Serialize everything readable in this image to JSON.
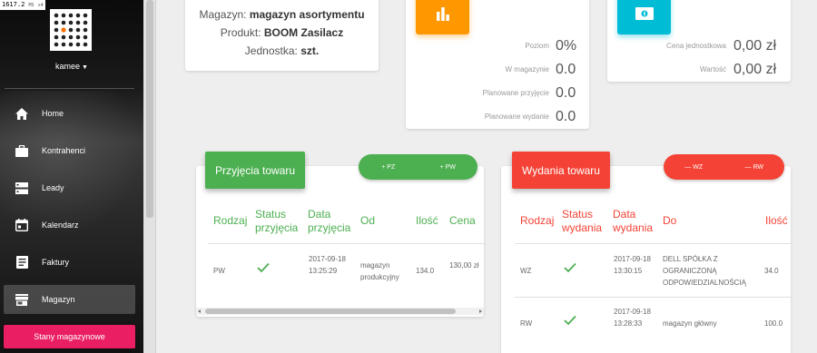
{
  "fps": {
    "value": "1617.2",
    "unit": "MS",
    "extra": "x4"
  },
  "sidebar": {
    "user": "kamee",
    "items": [
      {
        "label": "Home",
        "icon": "home-icon"
      },
      {
        "label": "Kontrahenci",
        "icon": "briefcase-icon"
      },
      {
        "label": "Leady",
        "icon": "storage-icon"
      },
      {
        "label": "Kalendarz",
        "icon": "calendar-icon"
      },
      {
        "label": "Faktury",
        "icon": "document-icon"
      },
      {
        "label": "Magazyn",
        "icon": "store-icon"
      }
    ],
    "submenu": "Stany magazynowe"
  },
  "info": {
    "magazyn_label": "Magazyn:",
    "magazyn_value": "magazyn asortymentu",
    "produkt_label": "Produkt:",
    "produkt_value": "BOOM Zasilacz",
    "jednostka_label": "Jednostka:",
    "jednostka_value": "szt."
  },
  "stats": {
    "poziom_label": "Poziom",
    "poziom_value": "0%",
    "magazyn_label": "W magazynie",
    "magazyn_value": "0.0",
    "przyjecie_label": "Planowane przyjęcie",
    "przyjecie_value": "0.0",
    "wydanie_label": "Planowane wydanie",
    "wydanie_value": "0.0"
  },
  "value_card": {
    "cena_label": "Cena jednostkowa",
    "cena_value": "0,00 zł",
    "wartosc_label": "Wartość",
    "wartosc_value": "0,00 zł"
  },
  "przyjecia": {
    "title": "Przyjęcia towaru",
    "btn_pz": "PZ",
    "btn_pw": "PW",
    "headers": [
      "Rodzaj",
      "Status przyjęcia",
      "Data przyjęcia",
      "Od",
      "Ilość",
      "Cena"
    ],
    "rows": [
      {
        "rodzaj": "PW",
        "data": "2017-09-18 13:25:29",
        "od": "magazyn produkcyjny",
        "ilosc": "134.0",
        "cena": "130,00 zł"
      }
    ]
  },
  "wydania": {
    "title": "Wydania towaru",
    "btn_wz": "WZ",
    "btn_rw": "RW",
    "headers": [
      "Rodzaj",
      "Status wydania",
      "Data wydania",
      "Do",
      "Ilość"
    ],
    "rows": [
      {
        "rodzaj": "WZ",
        "data": "2017-09-18 13:30:15",
        "do": "DELL SPÓŁKA Z OGRANICZONĄ ODPOWIEDZIALNOŚCIĄ",
        "ilosc": "34.0"
      },
      {
        "rodzaj": "RW",
        "data": "2017-09-18 13:28:33",
        "do": "magazyn główny",
        "ilosc": "100.0"
      }
    ]
  },
  "colors": {
    "green": "#4caf50",
    "red": "#f44336",
    "orange": "#ff9800",
    "cyan": "#00bcd4",
    "pink": "#e91e63"
  }
}
